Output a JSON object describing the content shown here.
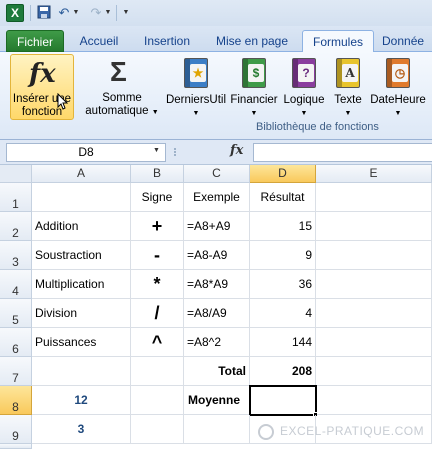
{
  "quick_access": {
    "app_icon": "excel-icon",
    "items": [
      "save-icon",
      "undo-icon",
      "redo-icon",
      "customize-icon"
    ]
  },
  "tabs": [
    "Fichier",
    "Accueil",
    "Insertion",
    "Mise en page",
    "Formules",
    "Donnée"
  ],
  "active_tab": "Formules",
  "ribbon": {
    "insert_function": {
      "icon": "fx",
      "label_line1": "Insérer une",
      "label_line2": "fonction"
    },
    "autosum": {
      "icon": "Σ",
      "label_line1": "Somme",
      "label_line2": "automatique"
    },
    "recent": {
      "label": "DerniersUtil",
      "symbol": "★"
    },
    "financial": {
      "label": "Financier",
      "symbol": "$"
    },
    "logical": {
      "label": "Logique",
      "symbol": "?"
    },
    "text": {
      "label": "Texte",
      "symbol": "A"
    },
    "datetime": {
      "label": "DateHeure",
      "symbol": "◷"
    },
    "group_label": "Bibliothèque de fonctions"
  },
  "formula_bar": {
    "name_box": "D8",
    "fx_label": "fx",
    "formula": ""
  },
  "columns": [
    "A",
    "B",
    "C",
    "D",
    "E"
  ],
  "rows": [
    "1",
    "2",
    "3",
    "4",
    "5",
    "6",
    "7",
    "8",
    "9"
  ],
  "selected_cell": "D8",
  "cells": {
    "B1": "Signe",
    "C1": "Exemple",
    "D1": "Résultat",
    "A2": "Addition",
    "B2": "+",
    "C2": "=A8+A9",
    "D2": "15",
    "A3": "Soustraction",
    "B3": "-",
    "C3": "=A8-A9",
    "D3": "9",
    "A4": "Multiplication",
    "B4": "*",
    "C4": "=A8*A9",
    "D4": "36",
    "A5": "Division",
    "B5": "/",
    "C5": "=A8/A9",
    "D5": "4",
    "A6": "Puissances",
    "B6": "^",
    "C6": "=A8^2",
    "D6": "144",
    "C7": "Total",
    "D7": "208",
    "A8": "12",
    "C8": "Moyenne",
    "A9": "3"
  },
  "watermark": "EXCEL-PRATIQUE.COM",
  "colors": {
    "accent_file_tab": "#257a2e",
    "selection": "#f9c95c",
    "value_blue": "#1f497d"
  }
}
